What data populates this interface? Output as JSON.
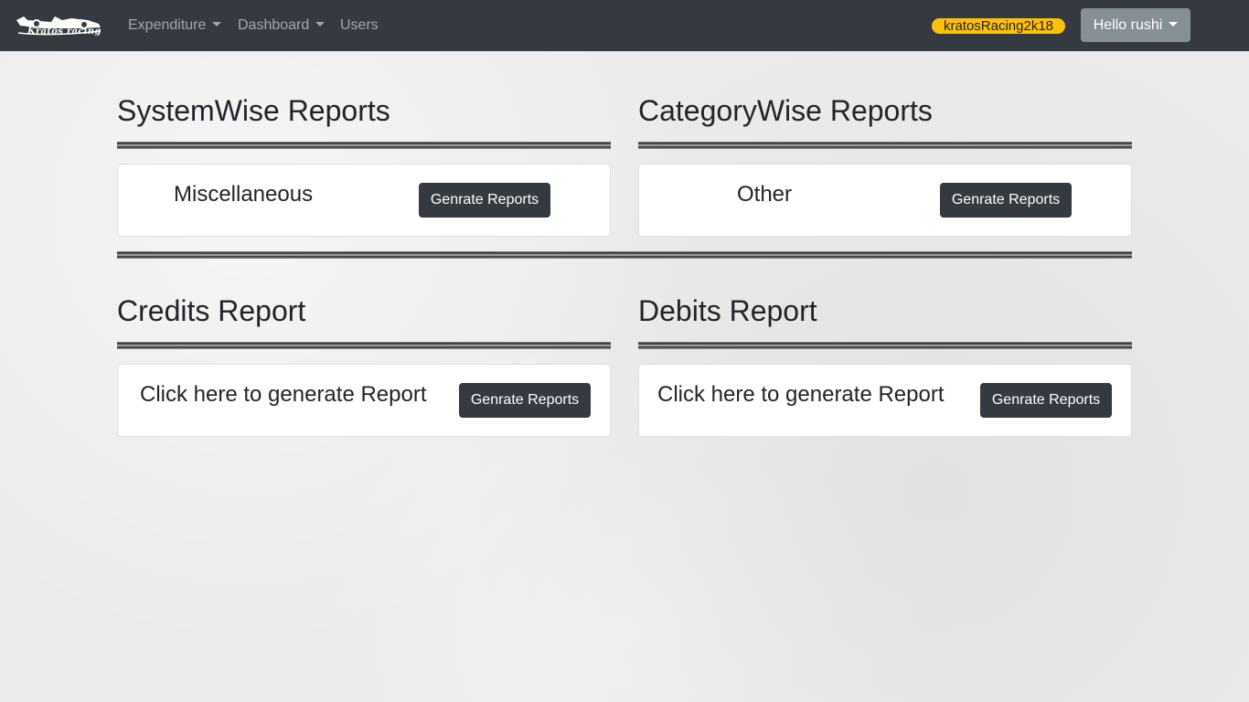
{
  "navbar": {
    "brand_name": "Kratos racing",
    "menu": [
      {
        "label": "Expenditure"
      },
      {
        "label": "Dashboard"
      },
      {
        "label": "Users"
      }
    ],
    "team_badge": "kratosRacing2k18",
    "user_menu_label": "Hello rushi"
  },
  "sections": {
    "systemwise": {
      "title": "SystemWise Reports",
      "card_text": "Miscellaneous",
      "button_label": "Genrate Reports"
    },
    "categorywise": {
      "title": "CategoryWise Reports",
      "card_text": "Other",
      "button_label": "Genrate Reports"
    },
    "credits": {
      "title": "Credits Report",
      "card_text": "Click here to generate Report",
      "button_label": "Genrate Reports"
    },
    "debits": {
      "title": "Debits Report",
      "card_text": "Click here to generate Report",
      "button_label": "Genrate Reports"
    }
  },
  "colors": {
    "navbar_bg": "#343a40",
    "badge_bg": "#ffc107",
    "user_button_bg": "#868e96",
    "action_button_bg": "#343a40"
  }
}
